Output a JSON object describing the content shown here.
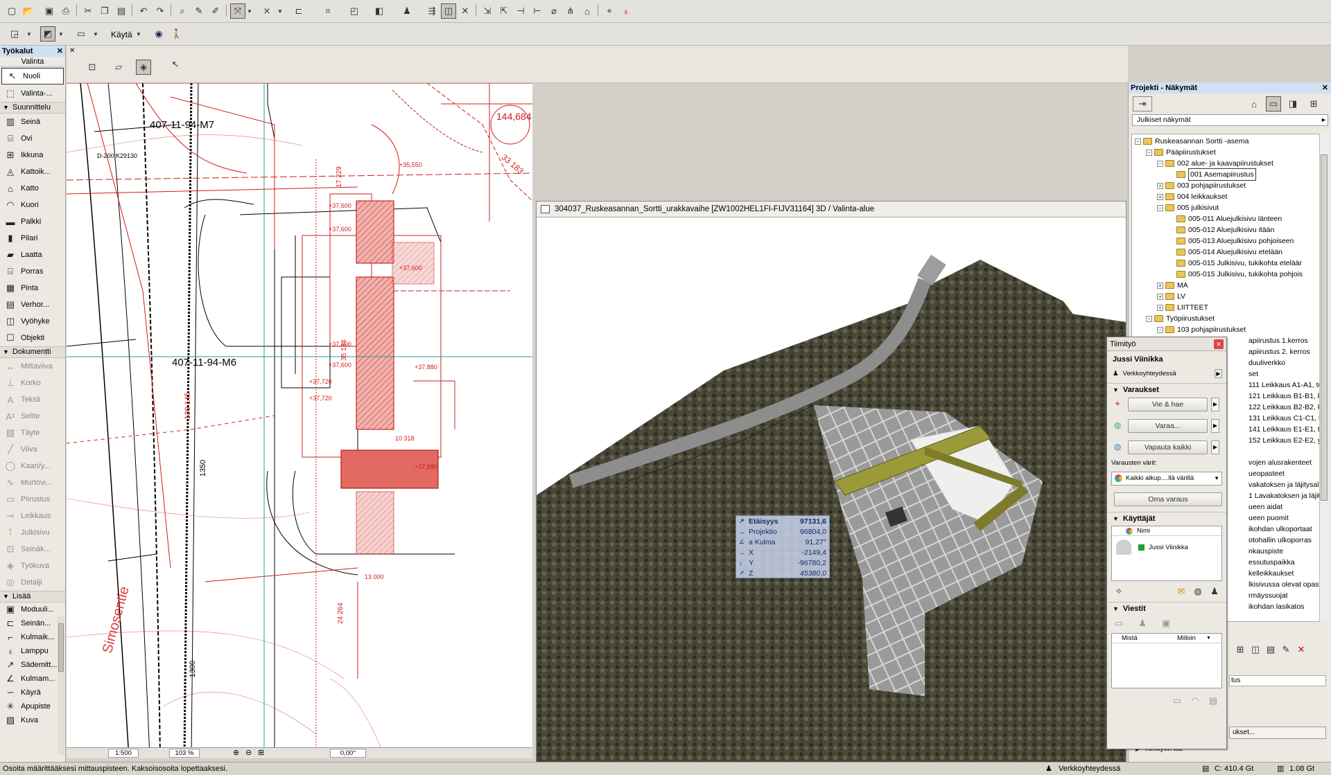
{
  "toolbar2": {
    "apply_label": "Käytä"
  },
  "palette": {
    "title": "Työkalut",
    "subtitle": "Valinta",
    "top_items": [
      {
        "label": "Nuoli",
        "icon": "arrow-pointer-icon"
      },
      {
        "label": "Valinta-...",
        "icon": "marquee-icon"
      }
    ],
    "sections": [
      {
        "label": "Suunnittelu",
        "items": [
          {
            "label": "Seinä",
            "icon": "wall-icon"
          },
          {
            "label": "Ovi",
            "icon": "door-icon"
          },
          {
            "label": "Ikkuna",
            "icon": "window-icon"
          },
          {
            "label": "Kattoik...",
            "icon": "skylight-icon"
          },
          {
            "label": "Katto",
            "icon": "roof-icon"
          },
          {
            "label": "Kuori",
            "icon": "shell-icon"
          },
          {
            "label": "Palkki",
            "icon": "beam-icon"
          },
          {
            "label": "Pilari",
            "icon": "column-icon"
          },
          {
            "label": "Laatta",
            "icon": "slab-icon"
          },
          {
            "label": "Porras",
            "icon": "stair-icon"
          },
          {
            "label": "Pinta",
            "icon": "mesh-icon"
          },
          {
            "label": "Verhor...",
            "icon": "curtain-wall-icon"
          },
          {
            "label": "Vyöhyke",
            "icon": "zone-icon"
          },
          {
            "label": "Objekti",
            "icon": "object-icon"
          }
        ]
      },
      {
        "label": "Dokumentti",
        "items": [
          {
            "label": "Mittaviiva",
            "icon": "dimension-icon"
          },
          {
            "label": "Korko",
            "icon": "level-icon"
          },
          {
            "label": "Teksti",
            "icon": "text-icon"
          },
          {
            "label": "Selite",
            "icon": "label-icon"
          },
          {
            "label": "Täyte",
            "icon": "fill-icon"
          },
          {
            "label": "Viiva",
            "icon": "line-icon"
          },
          {
            "label": "Kaari/y...",
            "icon": "arc-icon"
          },
          {
            "label": "Murtovi...",
            "icon": "polyline-icon"
          },
          {
            "label": "Piirustus",
            "icon": "drawing-icon"
          },
          {
            "label": "Leikkaus",
            "icon": "section-icon"
          },
          {
            "label": "Julkisivu",
            "icon": "elevation-icon"
          },
          {
            "label": "Seinäk...",
            "icon": "interior-elevation-icon"
          },
          {
            "label": "Työkuva",
            "icon": "worksheet-icon"
          },
          {
            "label": "Detalji",
            "icon": "detail-icon"
          }
        ]
      },
      {
        "label": "Lisää",
        "items": [
          {
            "label": "Moduuli...",
            "icon": "module-icon"
          },
          {
            "label": "Seinän...",
            "icon": "wall-end-icon"
          },
          {
            "label": "Kulmaik...",
            "icon": "corner-window-icon"
          },
          {
            "label": "Lamppu",
            "icon": "lamp-icon"
          },
          {
            "label": "Sädemitt...",
            "icon": "radial-dimension-icon"
          },
          {
            "label": "Kulmam...",
            "icon": "angle-dimension-icon"
          },
          {
            "label": "Käyrä",
            "icon": "spline-icon"
          },
          {
            "label": "Apupiste",
            "icon": "hotspot-icon"
          },
          {
            "label": "Kuva",
            "icon": "figure-icon"
          }
        ]
      }
    ]
  },
  "plan": {
    "labels": [
      "407-11-94-M7",
      "407-11-94-M6",
      "Simosentie",
      "144,684",
      "33 183",
      "D-200 K29130"
    ],
    "dims": [
      "17 229",
      "35 134",
      "130 145",
      "1350",
      "24 264",
      "10 318",
      "13 000",
      "1300",
      "1350"
    ],
    "levels": [
      "+37,600",
      "+37,600",
      "+37,600",
      "+37,600",
      "+37,720",
      "+37,720",
      "+37,880",
      "+37,880",
      "+35,550",
      "+37,600"
    ],
    "statusbar": {
      "scale": "1:500",
      "zoom": "103 %",
      "angle": "0,00°"
    }
  },
  "window3d": {
    "title": "304037_Ruskeasannan_Sortti_urakkavaihe  [ZW1002HEL1FI-FIJV31164] 3D / Valinta-alue"
  },
  "measure": {
    "rows": [
      {
        "label": "Etäisyys",
        "value": "97131,6",
        "bold": true
      },
      {
        "label": "Projektio",
        "value": "96804,0"
      },
      {
        "label": "a  Kulma",
        "value": "91,27°"
      },
      {
        "label": "X",
        "value": "-2149,4"
      },
      {
        "label": "Y",
        "value": "-96780,2"
      },
      {
        "label": "Z",
        "value": "45380,0"
      }
    ]
  },
  "navigator": {
    "title": "Projekti - Näkymät",
    "dropdown": "Julkiset näkymät",
    "tree": [
      {
        "label": "Ruskeasannan Sortti -asema",
        "indent": 0,
        "pm": "-"
      },
      {
        "label": "Pääpiirustukset",
        "indent": 1,
        "pm": "-"
      },
      {
        "label": "002 alue- ja kaavapiirustukset",
        "indent": 2,
        "pm": "-"
      },
      {
        "label": "001 Asemapiirustus",
        "indent": 3,
        "pm": "",
        "selected": true
      },
      {
        "label": "003 pohjapiirustukset",
        "indent": 2,
        "pm": "+"
      },
      {
        "label": "004 leikkaukset",
        "indent": 2,
        "pm": "+"
      },
      {
        "label": "005 julkisivut",
        "indent": 2,
        "pm": "-"
      },
      {
        "label": "005-011 Aluejulkisivu länteen",
        "indent": 3,
        "pm": ""
      },
      {
        "label": "005-012 Aluejulkisivu itään",
        "indent": 3,
        "pm": ""
      },
      {
        "label": "005-013 Aluejulkisivu pohjoiseen",
        "indent": 3,
        "pm": ""
      },
      {
        "label": "005-014 Aluejulkisivu etelään",
        "indent": 3,
        "pm": ""
      },
      {
        "label": "005-015 Julkisivu, tukikohta eteläär",
        "indent": 3,
        "pm": ""
      },
      {
        "label": "005-015 Julkisivu, tukikohta pohjois",
        "indent": 3,
        "pm": ""
      },
      {
        "label": "MA",
        "indent": 2,
        "pm": "+"
      },
      {
        "label": "LV",
        "indent": 2,
        "pm": "+"
      },
      {
        "label": "LIITTEET",
        "indent": 2,
        "pm": "+"
      },
      {
        "label": "Työpiirustukset",
        "indent": 1,
        "pm": "-"
      },
      {
        "label": "103 pohjapiirustukset",
        "indent": 2,
        "pm": "-"
      }
    ],
    "tree_hidden": [
      "apiirustus 1.kerros",
      "apiirustus 2. kerros",
      "duuliverkko",
      "set",
      "111 Leikkaus A1-A1, tukikoh",
      "121 Leikkaus B1-B1, konttik",
      "122 Leikkaus B2-B2, konttik",
      "131 Leikkaus C1-C1, huolto",
      "141 Leikkaus E1-E1, tukikoh",
      "152 Leikkaus E2-E2, yhteine",
      "",
      "vojen alusrakenteet",
      "ueopasteet",
      "vakatoksen ja läjitysaluee",
      "1 Lavakatoksen ja läjitysaluee",
      "ueen aidat",
      "ueen puomit",
      "ikohdan ulkoportaat",
      "otohallin ulkoporras",
      "nkauspiste",
      "essutuspaikka",
      "kelleikkaukset",
      "lkisivussa olevat opasteet",
      "rmäyssuojat",
      "ikohdan lasikatos"
    ],
    "bottom_field": "tus",
    "bottom_btn": "ukset...",
    "bottom_folder": "Tiimityön tila"
  },
  "teamwork": {
    "title": "Tiimityö",
    "user": "Jussi Viinikka",
    "connection": "Verkkoyhteydessä",
    "reservations_header": "Varaukset",
    "btn_show_get": "Vie & hae",
    "btn_reserve": "Varaa...",
    "btn_release_all": "Vapauta kaikki",
    "colors_label": "Varausten värit:",
    "colors_select": "Kaikki alkup....llä värillä",
    "btn_own": "Oma varaus",
    "users_header": "Käyttäjät",
    "users_col": "Nimi",
    "users": [
      "Jussi Viinikka"
    ],
    "messages_header": "Viestit",
    "msg_col_from": "Mistä",
    "msg_col_when": "Milloin"
  },
  "status": {
    "message": "Osoita määrittääksesi mittauspisteen. Kaksoisosoita lopettaaksesi.",
    "connection": "Verkkoyhteydessä",
    "disk_c": "C: 410.4 Gt",
    "disk_2": "1.08 Gt"
  },
  "colors": {
    "accent": "#cfe0f2",
    "plan_red": "#d11c1c",
    "hatch_red": "#e7807a",
    "building_olive": "#9c9a38"
  }
}
